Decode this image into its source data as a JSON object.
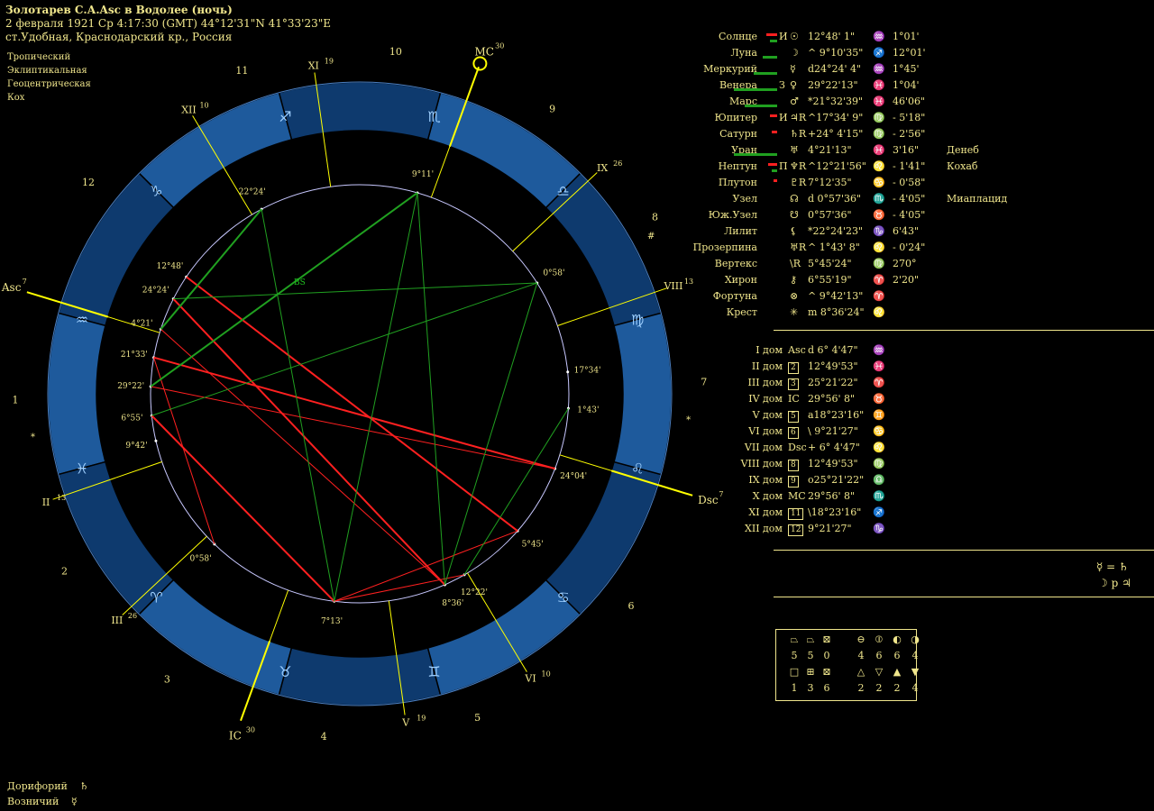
{
  "header": {
    "title": "Золотарев С.А.Asc в Водолее (ночь)",
    "datetime": "2 февраля 1921  Ср   4:17:30 (GMT) 44°12'31\"N  41°33'23\"E",
    "place": "ст.Удобная, Краснодарский кр., Россия"
  },
  "chart_settings": [
    "Тропический",
    "Эклиптикальная",
    "Геоцентрическая",
    "Кох"
  ],
  "colors": {
    "background": "#000000",
    "text": "#f0e68c",
    "ring": "#1e5a9c",
    "ring_dark": "#0e3a6e",
    "aspect_red": "#ff2020",
    "aspect_green": "#20a020",
    "house_line": "#ffff00"
  },
  "wheel_labels": {
    "asc": "Asc",
    "asc_deg": "7",
    "mc": "MC",
    "mc_deg": "30",
    "dsc": "Dsc",
    "dsc_deg": "7",
    "ic": "IC",
    "ic_deg": "30",
    "cusps": [
      {
        "label": "II",
        "deg": "13"
      },
      {
        "label": "III",
        "deg": "26"
      },
      {
        "label": "V",
        "deg": "19"
      },
      {
        "label": "VI",
        "deg": "10"
      },
      {
        "label": "VIII",
        "deg": "13"
      },
      {
        "label": "IX",
        "deg": "26"
      },
      {
        "label": "XI",
        "deg": "19"
      },
      {
        "label": "XII",
        "deg": "10"
      }
    ],
    "house_numbers": [
      "1",
      "2",
      "3",
      "4",
      "5",
      "6",
      "7",
      "8",
      "9",
      "10",
      "11",
      "12"
    ],
    "inner_labels": [
      "12°48'",
      "24°24'",
      "4°21'",
      "21°33'",
      "29°22'",
      "6°55'",
      "9°42'",
      "0°58'",
      "22°24'",
      "9°11'",
      "0°58'",
      "1°43'",
      "24°04'",
      "17°34'",
      "5°45'",
      "12°22'",
      "8°36'",
      "7°13'"
    ],
    "zodiac_glyphs": [
      "♒",
      "♓",
      "♈",
      "♉",
      "♊",
      "♋",
      "♌",
      "♍",
      "♎",
      "♏",
      "♐",
      "♑"
    ],
    "star_marks": [
      "*",
      "*",
      "#"
    ],
    "bs_label": "BS"
  },
  "planets": [
    {
      "name": "Солнце",
      "glyph": "☉",
      "flag": "И",
      "pos": "12°48' 1\"",
      "sign": "♒",
      "extra": "1°01'",
      "star": ""
    },
    {
      "name": "Луна",
      "glyph": "☽",
      "flag": "",
      "pos": "^  9°10'35\"",
      "sign": "♐",
      "extra": "12°01'",
      "star": ""
    },
    {
      "name": "Меркурий",
      "glyph": "☿",
      "flag": "",
      "pos": "d24°24' 4\"",
      "sign": "♒",
      "extra": "1°45'",
      "star": ""
    },
    {
      "name": "Венера",
      "glyph": "♀",
      "flag": "З",
      "pos": "29°22'13\"",
      "sign": "♓",
      "extra": "1°04'",
      "star": ""
    },
    {
      "name": "Марс",
      "glyph": "♂",
      "flag": "",
      "pos": "*21°32'39\"",
      "sign": "♓",
      "extra": "46'06\"",
      "star": ""
    },
    {
      "name": "Юпитер",
      "glyph": "♃R",
      "flag": "И",
      "pos": "^17°34' 9\"",
      "sign": "♍",
      "extra": "-  5'18\"",
      "star": ""
    },
    {
      "name": "Сатурн",
      "glyph": "♄R",
      "flag": "",
      "pos": "+24° 4'15\"",
      "sign": "♍",
      "extra": "-  2'56\"",
      "star": ""
    },
    {
      "name": "Уран",
      "glyph": "♅",
      "flag": "",
      "pos": "4°21'13\"",
      "sign": "♓",
      "extra": "3'16\"",
      "star": "Денеб"
    },
    {
      "name": "Нептун",
      "glyph": "♆R",
      "flag": "П",
      "pos": "^12°21'56\"",
      "sign": "♌",
      "extra": "-  1'41\"",
      "star": "Кохаб"
    },
    {
      "name": "Плутон",
      "glyph": "♇R",
      "flag": "",
      "pos": "7°12'35\"",
      "sign": "♋",
      "extra": "-  0'58\"",
      "star": ""
    },
    {
      "name": "Узел",
      "glyph": "☊",
      "flag": "",
      "pos": "d  0°57'36\"",
      "sign": "♏",
      "extra": "-  4'05\"",
      "star": "Миаплацид"
    },
    {
      "name": "Юж.Узел",
      "glyph": "☋",
      "flag": "",
      "pos": "0°57'36\"",
      "sign": "♉",
      "extra": "-  4'05\"",
      "star": ""
    },
    {
      "name": "Лилит",
      "glyph": "⚸",
      "flag": "",
      "pos": "*22°24'23\"",
      "sign": "♑",
      "extra": "6'43\"",
      "star": ""
    },
    {
      "name": "Прозерпина",
      "glyph": "♅R",
      "flag": "",
      "pos": "^  1°43' 8\"",
      "sign": "♌",
      "extra": "-  0'24\"",
      "star": ""
    },
    {
      "name": "Вертекс",
      "glyph": "\\R",
      "flag": "",
      "pos": "5°45'24\"",
      "sign": "♍",
      "extra": "270°",
      "star": ""
    },
    {
      "name": "Хирон",
      "glyph": "⚷",
      "flag": "",
      "pos": "6°55'19\"",
      "sign": "♈",
      "extra": "2'20\"",
      "star": ""
    },
    {
      "name": "Фортуна",
      "glyph": "⊗",
      "flag": "",
      "pos": "^  9°42'13\"",
      "sign": "♈",
      "extra": "",
      "star": ""
    },
    {
      "name": "Крест",
      "glyph": "✳",
      "flag": "",
      "pos": "m  8°36'24\"",
      "sign": "♌",
      "extra": "",
      "star": ""
    }
  ],
  "planet_bars": [
    {
      "red": 12,
      "green": 8
    },
    {
      "red": 0,
      "green": 16
    },
    {
      "red": 0,
      "green": 26
    },
    {
      "red": 0,
      "green": 48
    },
    {
      "red": 0,
      "green": 36
    },
    {
      "red": 8,
      "green": 0
    },
    {
      "red": 6,
      "green": 0
    },
    {
      "red": 0,
      "green": 48
    },
    {
      "red": 10,
      "green": 6
    },
    {
      "red": 4,
      "green": 0
    },
    {
      "red": 0,
      "green": 0
    },
    {
      "red": 0,
      "green": 0
    },
    {
      "red": 0,
      "green": 0
    },
    {
      "red": 0,
      "green": 0
    },
    {
      "red": 0,
      "green": 0
    },
    {
      "red": 0,
      "green": 0
    },
    {
      "red": 0,
      "green": 0
    },
    {
      "red": 0,
      "green": 0
    }
  ],
  "houses": [
    {
      "name": "I дом",
      "glyph": "Asc",
      "pos": "d  6° 4'47\"",
      "sign": "♒"
    },
    {
      "name": "II дом",
      "glyph": "2",
      "pos": "12°49'53\"",
      "sign": "♓"
    },
    {
      "name": "III дом",
      "glyph": "3",
      "pos": "25°21'22\"",
      "sign": "♈"
    },
    {
      "name": "IV дом",
      "glyph": "IC",
      "pos": "29°56' 8\"",
      "sign": "♉"
    },
    {
      "name": "V дом",
      "glyph": "5",
      "pos": "a18°23'16\"",
      "sign": "♊"
    },
    {
      "name": "VI дом",
      "glyph": "6",
      "pos": "\\  9°21'27\"",
      "sign": "♋"
    },
    {
      "name": "VII дом",
      "glyph": "Dsc",
      "pos": "+  6° 4'47\"",
      "sign": "♌"
    },
    {
      "name": "VIII дом",
      "glyph": "8",
      "pos": "12°49'53\"",
      "sign": "♍"
    },
    {
      "name": "IX дом",
      "glyph": "9",
      "pos": "o25°21'22\"",
      "sign": "♎"
    },
    {
      "name": "X дом",
      "glyph": "MC",
      "pos": "29°56' 8\"",
      "sign": "♏"
    },
    {
      "name": "XI дом",
      "glyph": "11",
      "pos": "\\18°23'16\"",
      "sign": "♐"
    },
    {
      "name": "XII дом",
      "glyph": "12",
      "pos": "9°21'27\"",
      "sign": "♑"
    }
  ],
  "aspect_notes": [
    "☿ = ♄",
    "☽ p ♃"
  ],
  "stats": {
    "row1_icons": [
      "trapezoid",
      "double-trapezoid",
      "box-triangle",
      "half-circle-h",
      "half-circle-v",
      "half-circle-r",
      "half-circle-l"
    ],
    "row1_values": [
      "5",
      "5",
      "0",
      "4",
      "6",
      "6",
      "4"
    ],
    "row2_icons": [
      "square",
      "grid-square",
      "x-square",
      "triangle-up",
      "triangle-down",
      "triangle-up-filled",
      "triangle-down-filled"
    ],
    "row2_values": [
      "1",
      "3",
      "6",
      "2",
      "2",
      "2",
      "4"
    ]
  },
  "footer": [
    {
      "label": "Дорифорий",
      "glyph": "♄"
    },
    {
      "label": "Возничий",
      "glyph": "☿"
    }
  ]
}
